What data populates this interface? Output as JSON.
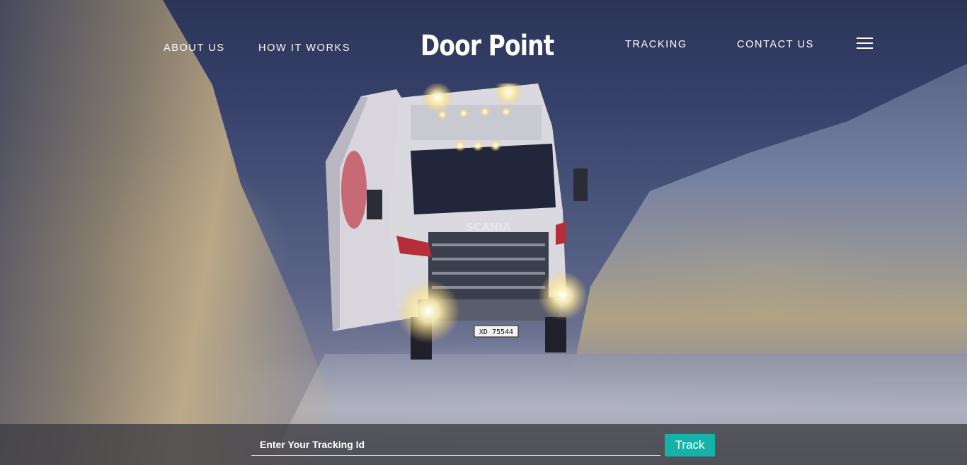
{
  "nav": {
    "about_us": "ABOUT US",
    "how_it_works": "HOW IT WORKS",
    "tracking": "TRACKING",
    "contact_us": "CONTACT US",
    "menu_icon": "hamburger-menu-icon"
  },
  "brand": {
    "name": "Door Point"
  },
  "truck": {
    "badge": "SCANIA",
    "plate": "XD 75544"
  },
  "tracking_form": {
    "placeholder": "Enter Your Tracking Id",
    "value": "",
    "button_label": "Track",
    "button_color": "#15b2a9"
  }
}
